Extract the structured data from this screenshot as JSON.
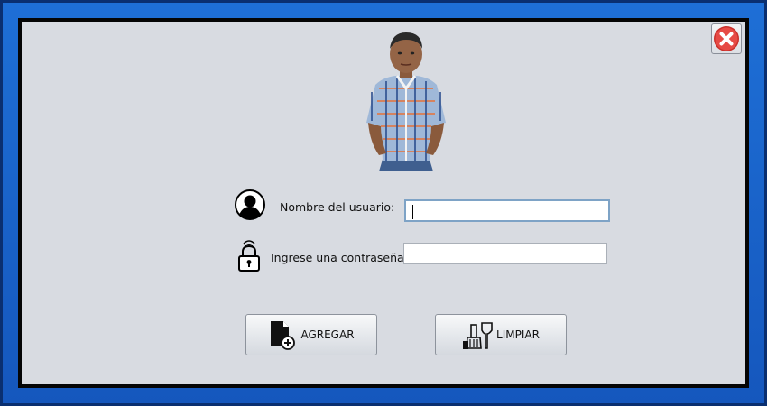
{
  "window": {
    "close_button": {
      "icon": "close-icon",
      "color": "#e23b3b"
    }
  },
  "profile_photo": {
    "icon": "user-photo"
  },
  "form": {
    "username": {
      "label": "Nombre del usuario:",
      "icon": "user-silhouette-icon",
      "value": ""
    },
    "password": {
      "label": "Ingrese una contraseña:",
      "icon": "padlock-icon",
      "value": ""
    }
  },
  "actions": {
    "add": {
      "label": "AGREGAR",
      "icon": "add-document-icon"
    },
    "clear": {
      "label": "LIMPIAR",
      "icon": "clean-tools-icon"
    }
  },
  "colors": {
    "frame_blue": "#1a63c9",
    "panel_bg": "#d8dbe1",
    "close_red": "#e23b3b"
  }
}
